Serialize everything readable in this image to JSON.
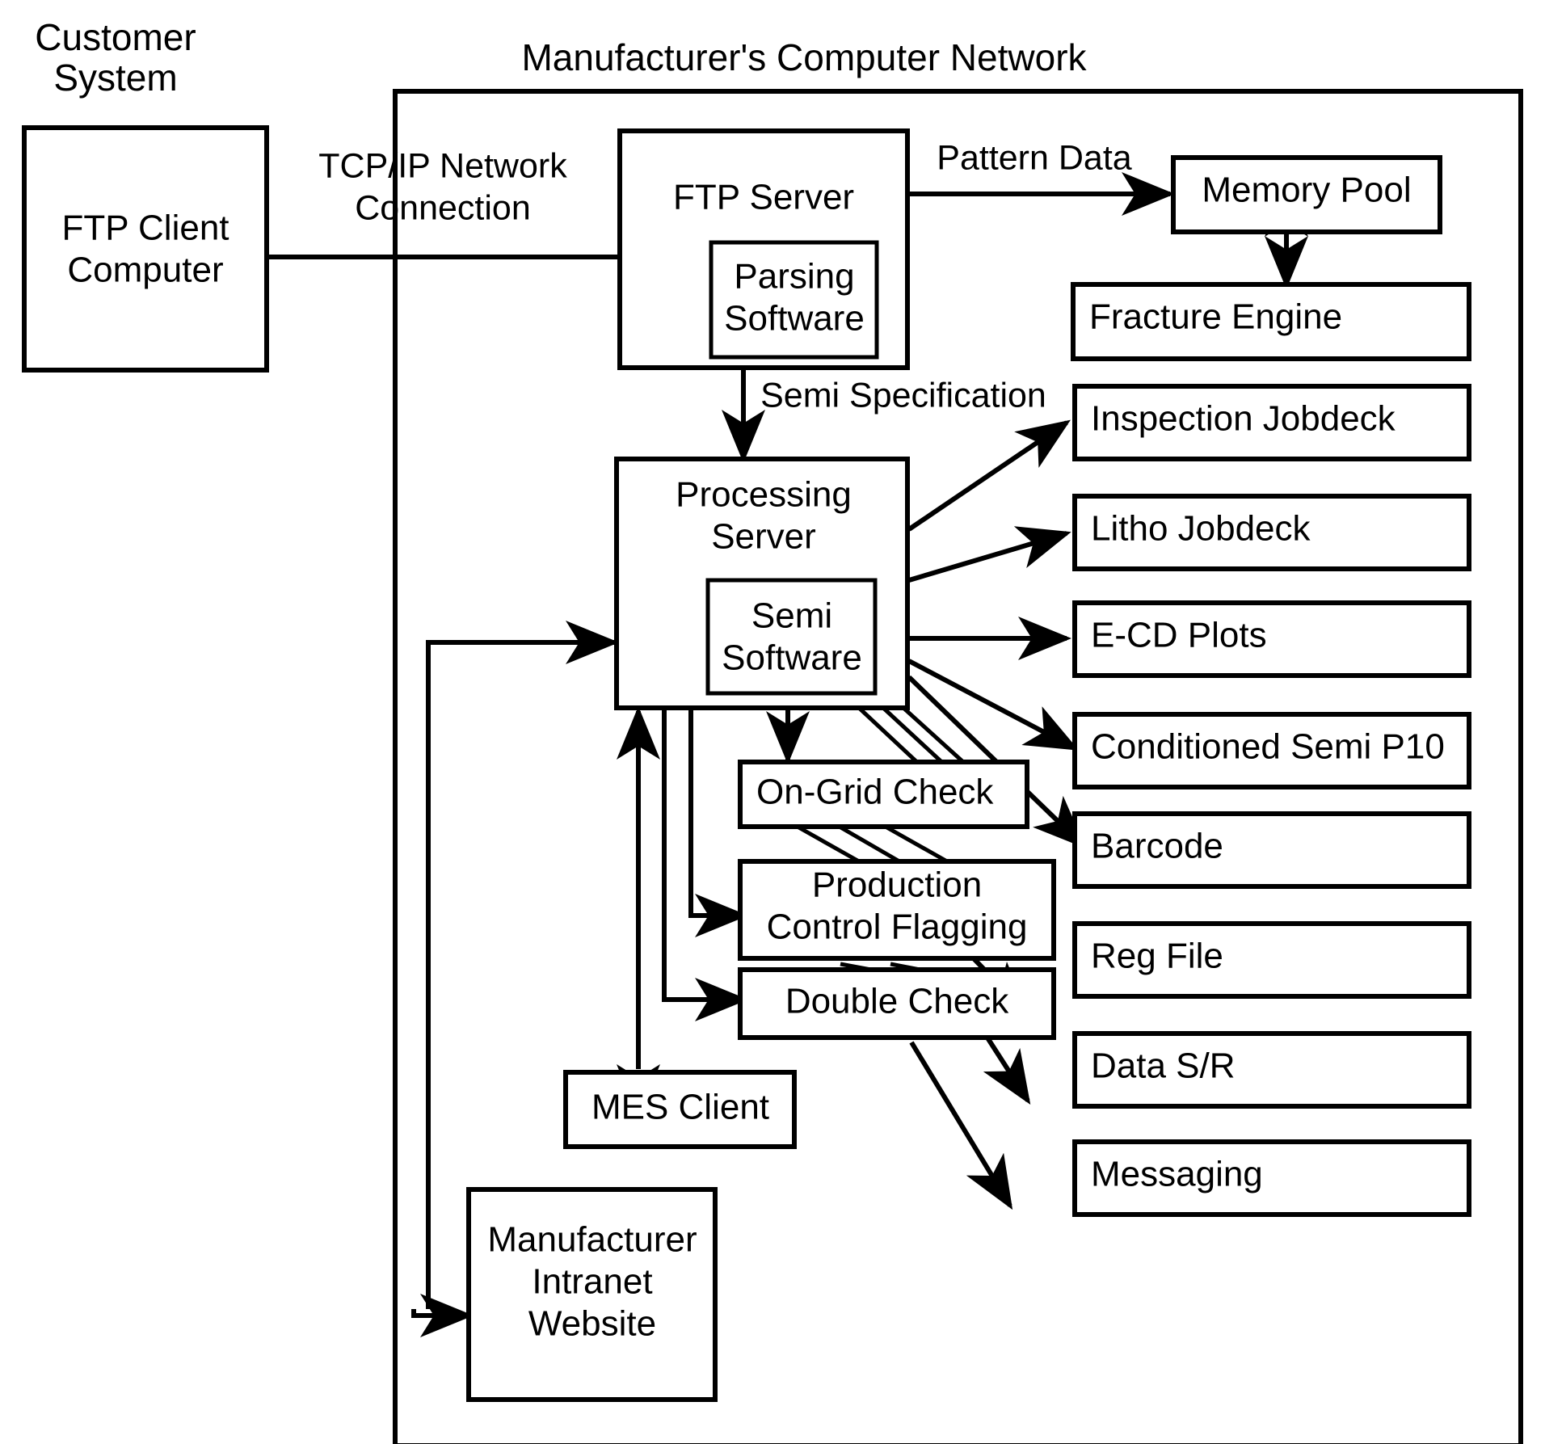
{
  "diagram": {
    "kind": "block-diagram",
    "title_left": "Customer System",
    "title_left_lines": [
      "Customer",
      "System"
    ],
    "title_right": "Manufacturer's Computer Network",
    "line_color": "#000000",
    "background_color": "#ffffff"
  },
  "groups": {
    "customer_system": {
      "label_lines": [
        "Customer",
        "System"
      ]
    },
    "manufacturer_network": {
      "label": "Manufacturer's Computer Network"
    }
  },
  "nodes": {
    "ftp_client": {
      "lines": [
        "FTP Client",
        "Computer"
      ],
      "label": "FTP Client Computer"
    },
    "ftp_server": {
      "label": "FTP Server"
    },
    "parsing_software": {
      "lines": [
        "Parsing",
        "Software"
      ],
      "label": "Parsing Software"
    },
    "processing_server": {
      "lines": [
        "Processing",
        "Server"
      ],
      "label": "Processing Server"
    },
    "semi_software": {
      "lines": [
        "Semi",
        "Software"
      ],
      "label": "Semi Software"
    },
    "memory_pool": {
      "label": "Memory Pool"
    },
    "fracture_engine": {
      "label": "Fracture Engine"
    },
    "inspection_jobdeck": {
      "label": "Inspection Jobdeck"
    },
    "litho_jobdeck": {
      "label": "Litho Jobdeck"
    },
    "ecd_plots": {
      "label": "E-CD Plots"
    },
    "conditioned_semi_p10": {
      "label": "Conditioned Semi P10"
    },
    "barcode": {
      "label": "Barcode"
    },
    "reg_file": {
      "label": "Reg File"
    },
    "data_sr": {
      "label": "Data S/R"
    },
    "messaging": {
      "label": "Messaging"
    },
    "on_grid_check": {
      "label": "On-Grid Check"
    },
    "production_control_flagging": {
      "lines": [
        "Production",
        "Control Flagging"
      ],
      "label": "Production Control Flagging"
    },
    "double_check": {
      "label": "Double Check"
    },
    "mes_client": {
      "label": "MES Client"
    },
    "manufacturer_intranet_website": {
      "lines": [
        "Manufacturer",
        "Intranet",
        "Website"
      ],
      "label": "Manufacturer Intranet Website"
    }
  },
  "edge_labels": {
    "tcpip": {
      "lines": [
        "TCP/IP Network",
        "Connection"
      ],
      "label": "TCP/IP Network Connection"
    },
    "pattern_data": {
      "label": "Pattern Data"
    },
    "semi_specification": {
      "label": "Semi Specification"
    }
  },
  "edges": [
    {
      "from": "ftp_client",
      "to": "ftp_server",
      "label": "TCP/IP Network Connection",
      "arrow": "none"
    },
    {
      "from": "ftp_server",
      "to": "memory_pool",
      "label": "Pattern Data",
      "arrow": "single"
    },
    {
      "from": "memory_pool",
      "to": "fracture_engine",
      "label": "",
      "arrow": "double"
    },
    {
      "from": "ftp_server",
      "to": "processing_server",
      "label": "Semi Specification",
      "arrow": "single"
    },
    {
      "from": "processing_server",
      "to": "inspection_jobdeck",
      "label": "",
      "arrow": "single"
    },
    {
      "from": "processing_server",
      "to": "litho_jobdeck",
      "label": "",
      "arrow": "single"
    },
    {
      "from": "processing_server",
      "to": "ecd_plots",
      "label": "",
      "arrow": "single"
    },
    {
      "from": "processing_server",
      "to": "conditioned_semi_p10",
      "label": "",
      "arrow": "single"
    },
    {
      "from": "processing_server",
      "to": "barcode",
      "label": "",
      "arrow": "single"
    },
    {
      "from": "processing_server",
      "to": "on_grid_check",
      "label": "",
      "arrow": "single"
    },
    {
      "from": "processing_server",
      "to": "production_control_flagging",
      "label": "",
      "arrow": "single"
    },
    {
      "from": "processing_server",
      "to": "double_check",
      "label": "",
      "arrow": "single"
    },
    {
      "from": "processing_server",
      "to": "mes_client",
      "label": "",
      "arrow": "double"
    },
    {
      "from": "production_control_flagging",
      "to": "reg_file",
      "label": "",
      "arrow": "single"
    },
    {
      "from": "double_check",
      "to": "data_sr",
      "label": "",
      "arrow": "single"
    },
    {
      "from": "double_check",
      "to": "messaging",
      "label": "",
      "arrow": "single"
    },
    {
      "from": "manufacturer_network",
      "to": "manufacturer_intranet_website",
      "label": "",
      "arrow": "single"
    },
    {
      "from": "manufacturer_network",
      "to": "processing_server",
      "label": "",
      "arrow": "single"
    }
  ]
}
